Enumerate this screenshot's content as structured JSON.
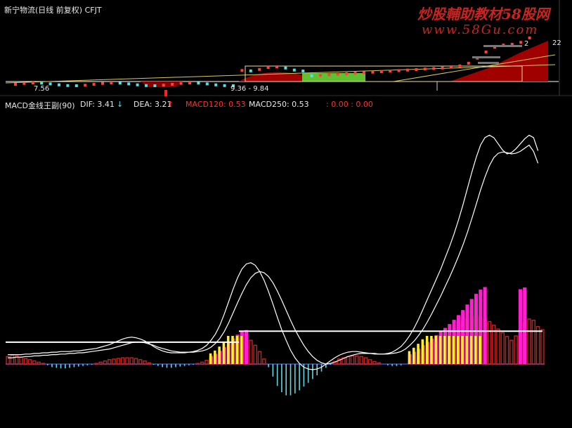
{
  "window": {
    "title": "新宁物流(日线 前复权) CFJT"
  },
  "watermark": {
    "line1": "炒股輔助教材58股网",
    "line2": "www.58Gu.com"
  },
  "price_panel": {
    "low_label": "7.56",
    "range_label": "9.36 - 9.84",
    "right_label": "22",
    "right_label2": "2"
  },
  "indicator_header": {
    "name": "MACD金线王副(90)",
    "dif": "DIF: 3.41",
    "dif_arrow": "↓",
    "dea": "DEA: 3.21",
    "dea_arrow": "↑",
    "macd120": "MACD120: 0.53",
    "macd250": "MACD250: 0.53",
    "zero_values": ": 0.00 : 0.00"
  },
  "colors": {
    "background": "#000000",
    "dif_line": "#ffffff",
    "dea_line": "#ffffff",
    "positive_bar": "#cc1f1f",
    "negative_bar": "#5fd7e0",
    "signal_bar_magenta": "#ff1fd0",
    "signal_bar_yellow": "#ffee22",
    "level_line": "#ffffff",
    "header_red": "#ff3030",
    "header_white": "#e8e8e8",
    "watermark": "#cc2222",
    "range_box": "#e8e0a0",
    "candle_up": "#ff4040",
    "candle_down": "#55e0e0",
    "area_fill_red": "#a00000",
    "area_fill_green": "#60c030"
  },
  "chart_data": {
    "type": "bar",
    "title": "MACD金线王副(90)",
    "series": [
      {
        "name": "MACD",
        "values": [
          0.12,
          0.14,
          0.13,
          0.11,
          0.09,
          0.07,
          0.05,
          0.03,
          0.01,
          -0.02,
          -0.05,
          -0.06,
          -0.07,
          -0.07,
          -0.06,
          -0.05,
          -0.04,
          -0.03,
          -0.02,
          -0.01,
          0.01,
          0.03,
          0.05,
          0.07,
          0.08,
          0.09,
          0.1,
          0.1,
          0.1,
          0.09,
          0.07,
          0.05,
          0.02,
          -0.01,
          -0.03,
          -0.05,
          -0.06,
          -0.06,
          -0.05,
          -0.04,
          -0.03,
          -0.02,
          -0.01,
          0.01,
          0.03,
          0.06,
          0.1,
          0.15,
          0.2,
          0.25,
          0.3,
          0.36,
          0.4,
          0.42,
          0.42,
          0.38,
          0.3,
          0.2,
          0.08,
          -0.05,
          -0.2,
          -0.35,
          -0.45,
          -0.5,
          -0.5,
          -0.47,
          -0.42,
          -0.36,
          -0.3,
          -0.24,
          -0.18,
          -0.12,
          -0.06,
          -0.01,
          0.04,
          0.08,
          0.1,
          0.12,
          0.13,
          0.13,
          0.12,
          0.1,
          0.07,
          0.04,
          0.02,
          0.0,
          -0.02,
          -0.03,
          -0.03,
          -0.02,
          0.0,
          0.03,
          0.07,
          0.12,
          0.18,
          0.24,
          0.3,
          0.35,
          0.4,
          0.45,
          0.5,
          0.56,
          0.62,
          0.68,
          0.72,
          0.75,
          0.76,
          0.75,
          0.72,
          0.68,
          0.62,
          0.56,
          0.5,
          0.44,
          0.38,
          0.45,
          0.55,
          0.65,
          0.72,
          0.7,
          0.6,
          0.55
        ]
      },
      {
        "name": "DIF",
        "values": [
          0.15,
          0.15,
          0.15,
          0.15,
          0.16,
          0.16,
          0.17,
          0.17,
          0.18,
          0.18,
          0.19,
          0.19,
          0.2,
          0.2,
          0.2,
          0.21,
          0.21,
          0.22,
          0.23,
          0.24,
          0.25,
          0.27,
          0.29,
          0.31,
          0.34,
          0.37,
          0.4,
          0.42,
          0.43,
          0.42,
          0.4,
          0.37,
          0.33,
          0.28,
          0.24,
          0.21,
          0.19,
          0.18,
          0.18,
          0.18,
          0.18,
          0.19,
          0.2,
          0.22,
          0.25,
          0.3,
          0.38,
          0.48,
          0.62,
          0.8,
          1.0,
          1.2,
          1.38,
          1.52,
          1.6,
          1.62,
          1.58,
          1.48,
          1.34,
          1.16,
          0.96,
          0.75,
          0.55,
          0.38,
          0.22,
          0.1,
          0.01,
          -0.05,
          -0.08,
          -0.09,
          -0.08,
          -0.05,
          0.0,
          0.05,
          0.1,
          0.14,
          0.17,
          0.19,
          0.2,
          0.2,
          0.19,
          0.18,
          0.17,
          0.16,
          0.16,
          0.16,
          0.17,
          0.19,
          0.23,
          0.28,
          0.36,
          0.46,
          0.58,
          0.72,
          0.88,
          1.04,
          1.2,
          1.36,
          1.52,
          1.7,
          1.88,
          2.08,
          2.3,
          2.54,
          2.8,
          3.06,
          3.3,
          3.5,
          3.62,
          3.66,
          3.62,
          3.52,
          3.42,
          3.36,
          3.38,
          3.44,
          3.52,
          3.6,
          3.66,
          3.62,
          3.41
        ]
      },
      {
        "name": "DEA",
        "values": [
          0.1,
          0.1,
          0.11,
          0.11,
          0.12,
          0.12,
          0.13,
          0.13,
          0.14,
          0.14,
          0.15,
          0.15,
          0.16,
          0.16,
          0.17,
          0.17,
          0.18,
          0.18,
          0.19,
          0.2,
          0.21,
          0.22,
          0.23,
          0.24,
          0.26,
          0.28,
          0.3,
          0.32,
          0.34,
          0.35,
          0.35,
          0.34,
          0.32,
          0.3,
          0.27,
          0.25,
          0.23,
          0.21,
          0.2,
          0.19,
          0.19,
          0.19,
          0.19,
          0.2,
          0.21,
          0.23,
          0.27,
          0.33,
          0.41,
          0.52,
          0.66,
          0.82,
          0.98,
          1.13,
          1.27,
          1.38,
          1.45,
          1.48,
          1.46,
          1.4,
          1.3,
          1.17,
          1.02,
          0.86,
          0.7,
          0.55,
          0.42,
          0.3,
          0.2,
          0.12,
          0.06,
          0.02,
          0.0,
          0.01,
          0.03,
          0.06,
          0.09,
          0.12,
          0.14,
          0.16,
          0.17,
          0.17,
          0.17,
          0.17,
          0.16,
          0.16,
          0.16,
          0.17,
          0.18,
          0.2,
          0.24,
          0.3,
          0.37,
          0.46,
          0.56,
          0.68,
          0.81,
          0.95,
          1.09,
          1.24,
          1.39,
          1.55,
          1.72,
          1.9,
          2.1,
          2.32,
          2.55,
          2.78,
          2.99,
          3.17,
          3.3,
          3.37,
          3.39,
          3.38,
          3.36,
          3.37,
          3.4,
          3.45,
          3.5,
          3.4,
          3.21
        ]
      }
    ],
    "reference_levels": [
      0.35,
      1.25
    ],
    "ylim": [
      -1.0,
      4.0
    ],
    "xlabel": "",
    "ylabel": "",
    "legend": "top-left",
    "grid": false
  }
}
